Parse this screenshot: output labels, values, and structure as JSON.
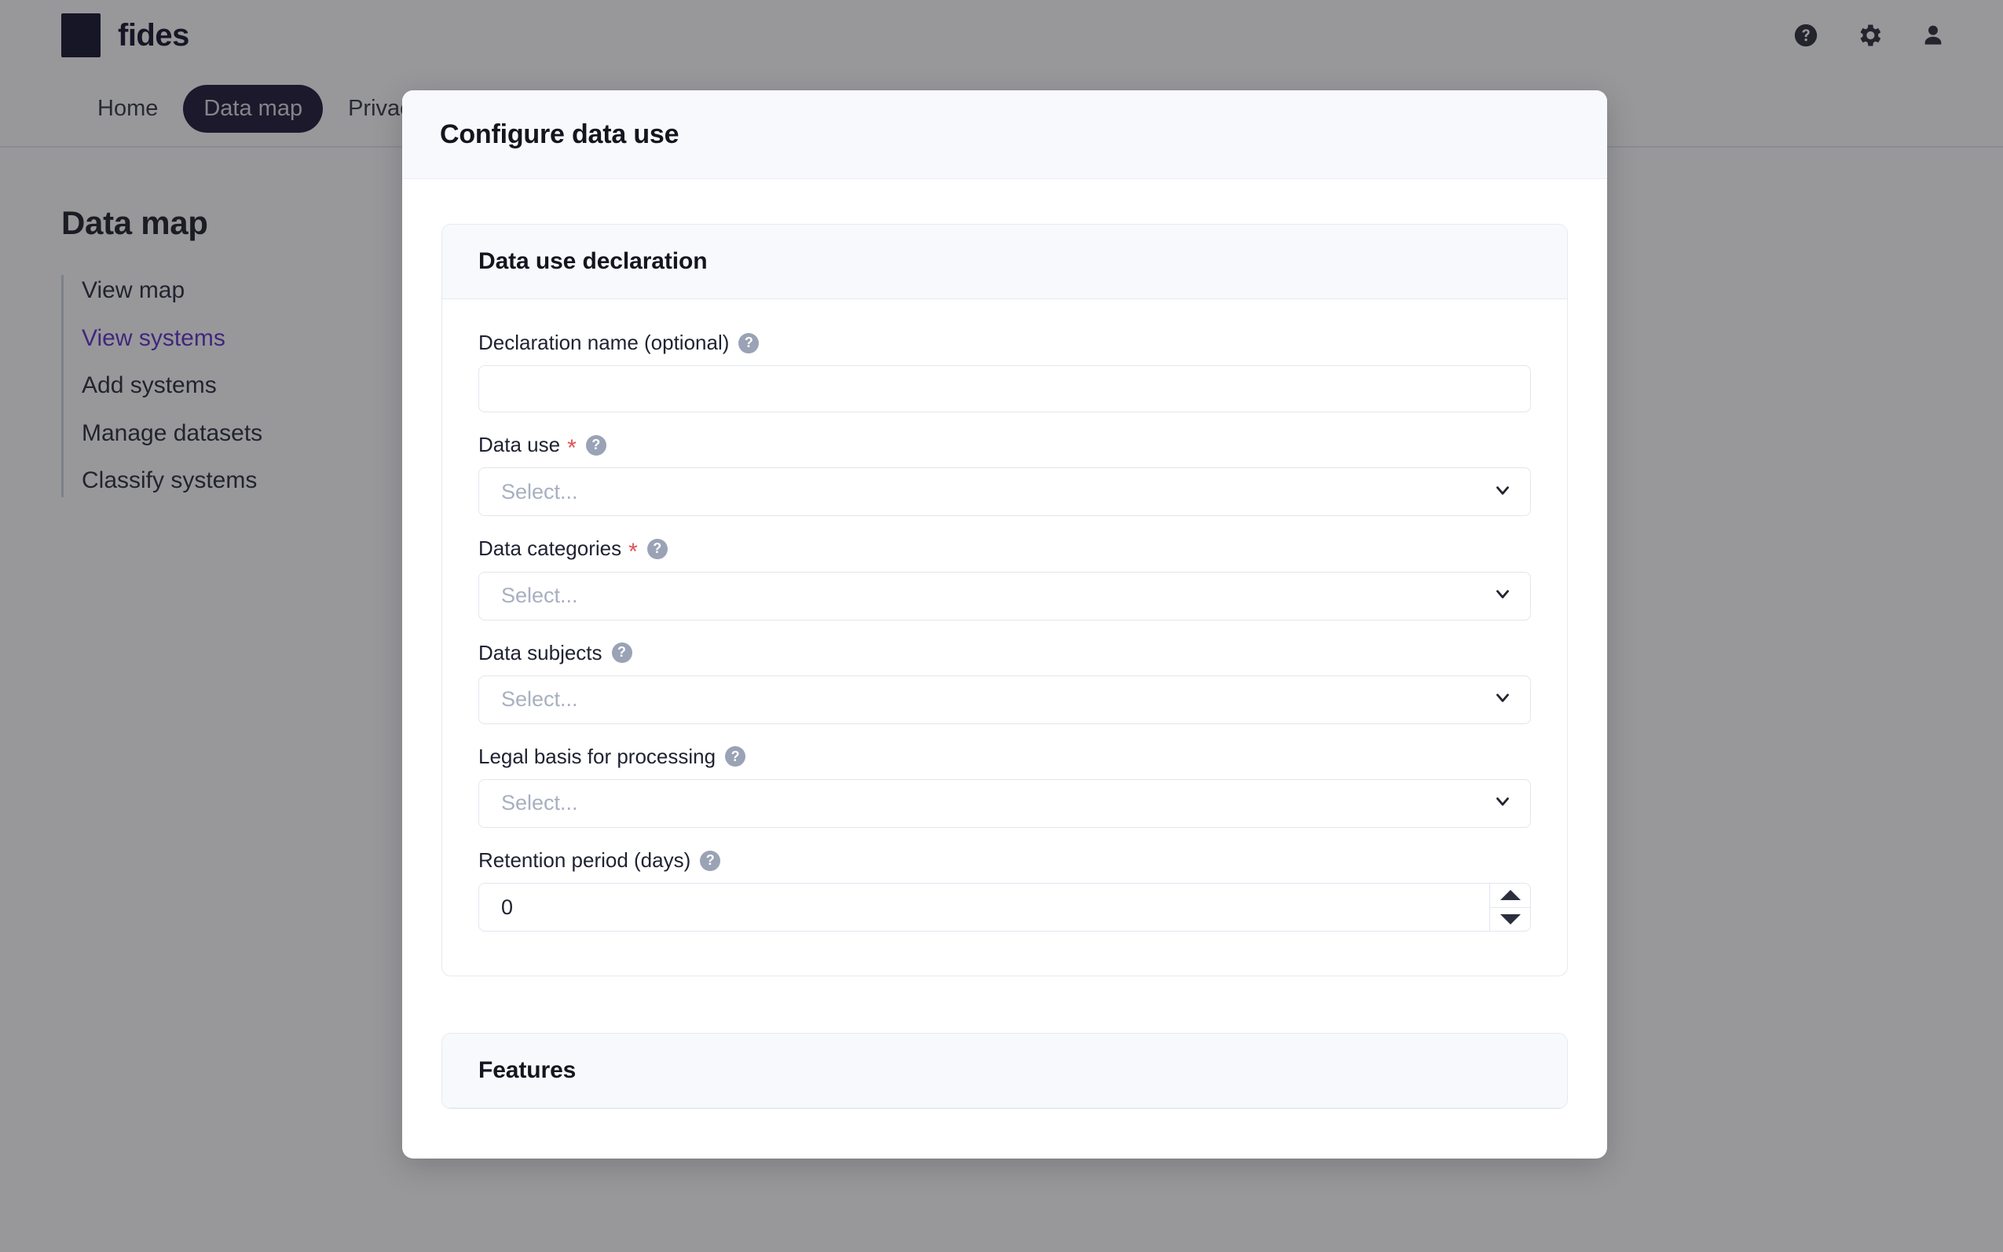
{
  "app": {
    "brand": {
      "name": "fides",
      "mark": "logo-square"
    },
    "topbar_icons": [
      {
        "name": "help-circle-icon"
      },
      {
        "name": "gear-icon"
      },
      {
        "name": "user-account-icon"
      }
    ],
    "nav": [
      {
        "label": "Home",
        "active": false
      },
      {
        "label": "Data map",
        "active": true
      },
      {
        "label": "Privacy",
        "active": false
      }
    ],
    "page_title": "Data map",
    "side_nav": [
      {
        "label": "View map",
        "active": false
      },
      {
        "label": "View systems",
        "active": true
      },
      {
        "label": "Add systems",
        "active": false
      },
      {
        "label": "Manage datasets",
        "active": false
      },
      {
        "label": "Classify systems",
        "active": false
      }
    ]
  },
  "modal": {
    "title": "Configure data use",
    "card": {
      "title": "Data use declaration",
      "fields": [
        {
          "label": "Declaration name (optional)",
          "required": false,
          "help": "?",
          "type": "text",
          "value": "",
          "placeholder": ""
        },
        {
          "label": "Data use",
          "required": true,
          "help": "?",
          "type": "select",
          "placeholder": "Select..."
        },
        {
          "label": "Data categories",
          "required": true,
          "help": "?",
          "type": "select",
          "placeholder": "Select..."
        },
        {
          "label": "Data subjects",
          "required": false,
          "help": "?",
          "type": "select",
          "placeholder": "Select..."
        },
        {
          "label": "Legal basis for processing",
          "required": false,
          "help": "?",
          "type": "select",
          "placeholder": "Select..."
        },
        {
          "label": "Retention period (days)",
          "required": false,
          "help": "?",
          "type": "number",
          "value": "0"
        }
      ]
    },
    "next_card": {
      "title": "Features"
    }
  },
  "colors": {
    "brand_dark": "#0d0a23",
    "accent_purple": "#5b29c7",
    "required_red": "#e05252",
    "card_header_bg": "#f8f9fc",
    "border": "#e6e9f1",
    "placeholder": "#a8b0c0"
  }
}
